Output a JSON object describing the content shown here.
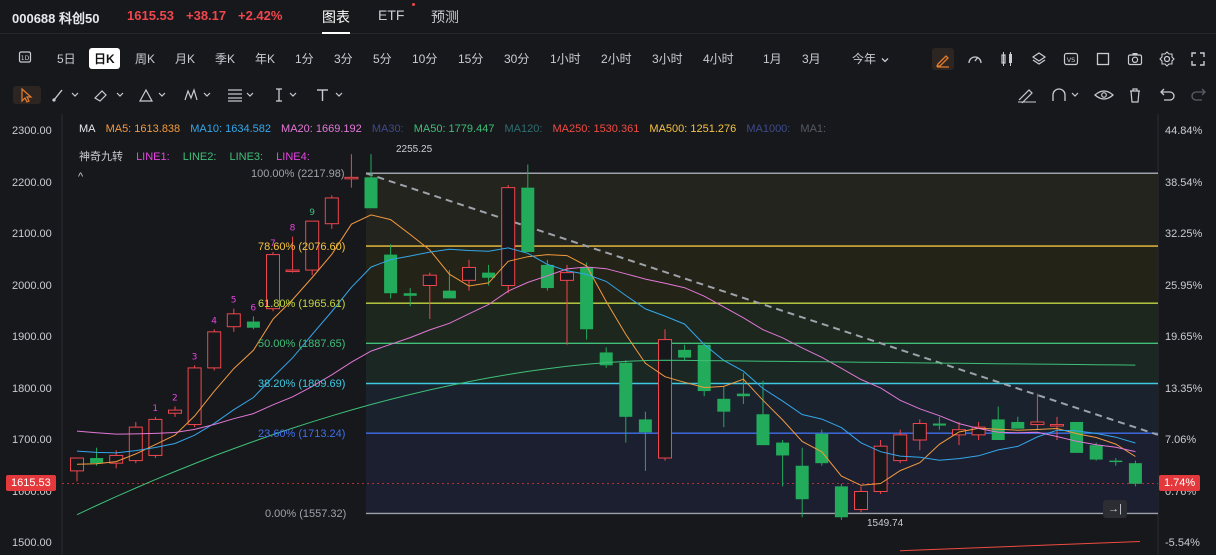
{
  "header": {
    "symbol": "000688 科创50",
    "price": "1615.53",
    "change": "+38.17",
    "change_pct": "+2.42%",
    "tabs": [
      {
        "label": "图表",
        "active": true
      },
      {
        "label": "ETF",
        "active": false
      },
      {
        "label": "预测",
        "active": false
      }
    ]
  },
  "periods": [
    "5日",
    "日K",
    "周K",
    "月K",
    "季K",
    "年K",
    "1分",
    "3分",
    "5分",
    "10分",
    "15分",
    "30分",
    "1小时",
    "2小时",
    "3小时",
    "4小时",
    "1月",
    "3月",
    "今年"
  ],
  "active_period": "日K",
  "colors": {
    "up": "#f0464d",
    "down": "#22ab5a",
    "bg": "#17181c",
    "accent": "#e87e2c"
  },
  "ma_legend": {
    "label": "MA",
    "items": [
      {
        "text": "MA5: 1613.838",
        "color": "#f29a3f"
      },
      {
        "text": "MA10: 1634.582",
        "color": "#34a7ea"
      },
      {
        "text": "MA20: 1669.192",
        "color": "#e178d6"
      },
      {
        "text": "MA30:",
        "color": "#3f4a8a"
      },
      {
        "text": "MA50: 1779.447",
        "color": "#3fbf78"
      },
      {
        "text": "MA120:",
        "color": "#2f6e71"
      },
      {
        "text": "MA250: 1530.361",
        "color": "#f04b42"
      },
      {
        "text": "MA500: 1251.276",
        "color": "#f5c242"
      },
      {
        "text": "MA1000:",
        "color": "#3f4a8a"
      },
      {
        "text": "MA1:",
        "color": "#555a63"
      }
    ]
  },
  "line_legend": {
    "items": [
      {
        "text": "神奇九转",
        "color": "#c9ccd3"
      },
      {
        "text": "LINE1:",
        "color": "#e445e0"
      },
      {
        "text": "LINE2:",
        "color": "#3fbf78"
      },
      {
        "text": "LINE3:",
        "color": "#3fbf78"
      },
      {
        "text": "LINE4:",
        "color": "#e445e0"
      }
    ],
    "collapse": "^"
  },
  "y_axis_left": [
    "2300.00",
    "2200.00",
    "2100.00",
    "2000.00",
    "1900.00",
    "1800.00",
    "1700.00",
    "1600.00",
    "1500.00"
  ],
  "y_axis_right": [
    "44.84%",
    "38.54%",
    "32.25%",
    "25.95%",
    "19.65%",
    "13.35%",
    "7.06%",
    "0.76%",
    "-5.54%"
  ],
  "fib_levels": [
    {
      "label": "100.00% (2217.98)",
      "color": "#9ea2aa"
    },
    {
      "label": "78.60% (2076.60)",
      "color": "#f5c242"
    },
    {
      "label": "61.80% (1965.61)",
      "color": "#c3d640"
    },
    {
      "label": "50.00% (1887.65)",
      "color": "#3fbf78"
    },
    {
      "label": "38.20% (1809.69)",
      "color": "#3fc8e0"
    },
    {
      "label": "23.60% (1713.24)",
      "color": "#3f6fe8"
    },
    {
      "label": "0.00% (1557.32)",
      "color": "#9ea2aa"
    }
  ],
  "high_label": "2255.25",
  "low_label": "1549.74",
  "last_price_tag": "1615.53",
  "last_pct_tag": "1.74%",
  "nine_turn_counts": [
    "1",
    "2",
    "3",
    "4",
    "5",
    "6",
    "7",
    "8",
    "9"
  ],
  "chart_data": {
    "type": "candlestick",
    "ylim": [
      1500,
      2300
    ],
    "candles": [
      {
        "o": 1640,
        "h": 1665,
        "l": 1620,
        "c": 1665
      },
      {
        "o": 1665,
        "h": 1685,
        "l": 1650,
        "c": 1655
      },
      {
        "o": 1655,
        "h": 1680,
        "l": 1645,
        "c": 1670
      },
      {
        "o": 1660,
        "h": 1735,
        "l": 1655,
        "c": 1725
      },
      {
        "o": 1670,
        "h": 1745,
        "l": 1665,
        "c": 1740
      },
      {
        "o": 1752,
        "h": 1765,
        "l": 1745,
        "c": 1758
      },
      {
        "o": 1730,
        "h": 1845,
        "l": 1725,
        "c": 1840
      },
      {
        "o": 1840,
        "h": 1915,
        "l": 1835,
        "c": 1910
      },
      {
        "o": 1920,
        "h": 1955,
        "l": 1910,
        "c": 1945
      },
      {
        "o": 1930,
        "h": 1940,
        "l": 1915,
        "c": 1918
      },
      {
        "o": 1955,
        "h": 2065,
        "l": 1950,
        "c": 2060
      },
      {
        "o": 2030,
        "h": 2095,
        "l": 2025,
        "c": 2030
      },
      {
        "o": 2030,
        "h": 2125,
        "l": 2020,
        "c": 2125
      },
      {
        "o": 2120,
        "h": 2175,
        "l": 2110,
        "c": 2170
      },
      {
        "o": 2210,
        "h": 2255,
        "l": 2190,
        "c": 2210
      },
      {
        "o": 2210,
        "h": 2255,
        "l": 2180,
        "c": 2150
      },
      {
        "o": 2060,
        "h": 2080,
        "l": 1975,
        "c": 1985
      },
      {
        "o": 1985,
        "h": 1995,
        "l": 1960,
        "c": 1980
      },
      {
        "o": 2000,
        "h": 2025,
        "l": 1935,
        "c": 2020
      },
      {
        "o": 1990,
        "h": 2030,
        "l": 1975,
        "c": 1975
      },
      {
        "o": 2010,
        "h": 2050,
        "l": 1990,
        "c": 2035
      },
      {
        "o": 2025,
        "h": 2040,
        "l": 2000,
        "c": 2015
      },
      {
        "o": 2000,
        "h": 2195,
        "l": 1985,
        "c": 2190
      },
      {
        "o": 2190,
        "h": 2235,
        "l": 2090,
        "c": 2065
      },
      {
        "o": 2040,
        "h": 2050,
        "l": 1990,
        "c": 1995
      },
      {
        "o": 2010,
        "h": 2040,
        "l": 1885,
        "c": 2025
      },
      {
        "o": 2035,
        "h": 2045,
        "l": 1895,
        "c": 1915
      },
      {
        "o": 1870,
        "h": 1880,
        "l": 1840,
        "c": 1845
      },
      {
        "o": 1850,
        "h": 1855,
        "l": 1695,
        "c": 1745
      },
      {
        "o": 1740,
        "h": 1755,
        "l": 1640,
        "c": 1715
      },
      {
        "o": 1665,
        "h": 1915,
        "l": 1660,
        "c": 1895
      },
      {
        "o": 1875,
        "h": 1885,
        "l": 1855,
        "c": 1860
      },
      {
        "o": 1885,
        "h": 1890,
        "l": 1785,
        "c": 1795
      },
      {
        "o": 1780,
        "h": 1805,
        "l": 1725,
        "c": 1755
      },
      {
        "o": 1790,
        "h": 1830,
        "l": 1770,
        "c": 1785
      },
      {
        "o": 1750,
        "h": 1815,
        "l": 1690,
        "c": 1690
      },
      {
        "o": 1695,
        "h": 1700,
        "l": 1610,
        "c": 1670
      },
      {
        "o": 1650,
        "h": 1685,
        "l": 1550,
        "c": 1585
      },
      {
        "o": 1712,
        "h": 1720,
        "l": 1650,
        "c": 1655
      },
      {
        "o": 1610,
        "h": 1615,
        "l": 1545,
        "c": 1550
      },
      {
        "o": 1565,
        "h": 1610,
        "l": 1560,
        "c": 1600
      },
      {
        "o": 1600,
        "h": 1700,
        "l": 1595,
        "c": 1688
      },
      {
        "o": 1660,
        "h": 1720,
        "l": 1655,
        "c": 1710
      },
      {
        "o": 1700,
        "h": 1740,
        "l": 1680,
        "c": 1732
      },
      {
        "o": 1732,
        "h": 1745,
        "l": 1720,
        "c": 1728
      },
      {
        "o": 1710,
        "h": 1735,
        "l": 1690,
        "c": 1720
      },
      {
        "o": 1710,
        "h": 1735,
        "l": 1700,
        "c": 1725
      },
      {
        "o": 1740,
        "h": 1765,
        "l": 1700,
        "c": 1700
      },
      {
        "o": 1735,
        "h": 1745,
        "l": 1725,
        "c": 1722
      },
      {
        "o": 1730,
        "h": 1790,
        "l": 1720,
        "c": 1735
      },
      {
        "o": 1730,
        "h": 1745,
        "l": 1700,
        "c": 1730
      },
      {
        "o": 1735,
        "h": 1655,
        "l": 1675,
        "c": 1675
      },
      {
        "o": 1690,
        "h": 1695,
        "l": 1660,
        "c": 1662
      },
      {
        "o": 1660,
        "h": 1665,
        "l": 1650,
        "c": 1658
      },
      {
        "o": 1655,
        "h": 1660,
        "l": 1610,
        "c": 1615
      }
    ]
  }
}
